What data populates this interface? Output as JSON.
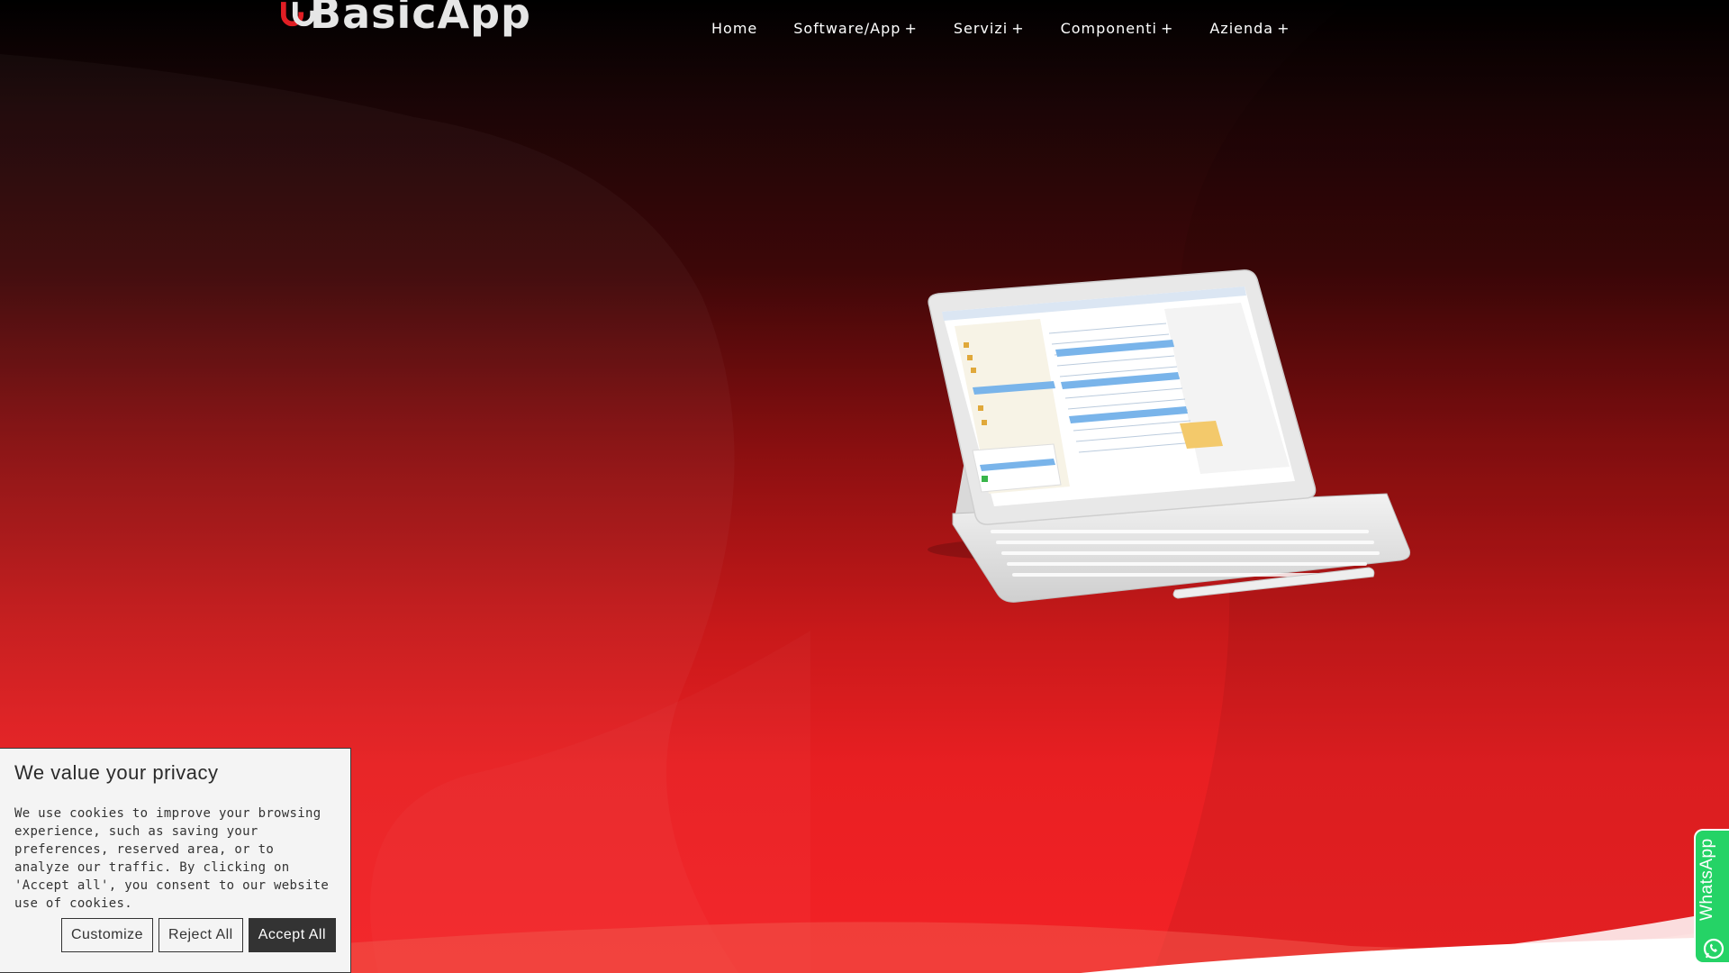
{
  "brand": {
    "name": "BasicApp",
    "logo_icon": "basicapp-logo-icon"
  },
  "nav": {
    "items": [
      {
        "label": "Home",
        "has_submenu": false,
        "suffix": ""
      },
      {
        "label": "Software/App",
        "has_submenu": true,
        "suffix": "+"
      },
      {
        "label": "Servizi",
        "has_submenu": true,
        "suffix": "+"
      },
      {
        "label": "Componenti",
        "has_submenu": true,
        "suffix": "+"
      },
      {
        "label": "Azienda",
        "has_submenu": true,
        "suffix": "+"
      }
    ]
  },
  "hero": {
    "image": "tablet-with-keyboard-app-screenshot"
  },
  "cookie": {
    "title": "We value your privacy",
    "text": "We use cookies to improve your browsing experience, such as saving your preferences, reserved area, or to analyze our traffic. By clicking on 'Accept all', you consent to our website use of cookies.",
    "customize_label": "Customize",
    "reject_label": "Reject All",
    "accept_label": "Accept All"
  },
  "whatsapp": {
    "label": "WhatsApp",
    "icon": "whatsapp-icon"
  },
  "colors": {
    "accent": "#e81f22",
    "header_bg": "#000000",
    "cookie_bg": "#f4f4f4",
    "whatsapp": "#25d366"
  }
}
